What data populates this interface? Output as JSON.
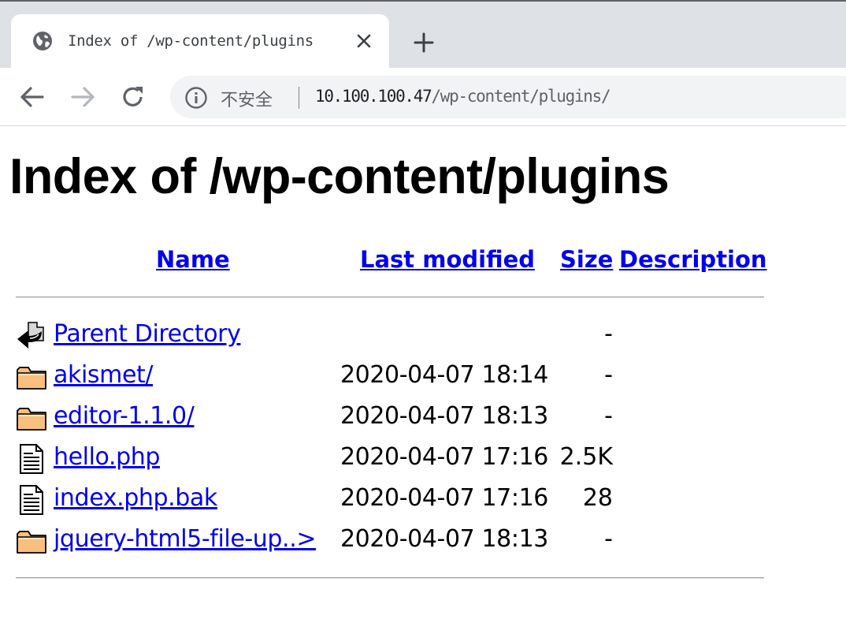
{
  "browser": {
    "tab_title": "Index of /wp-content/plugins",
    "security_label": "不安全",
    "url_host": "10.100.100.47",
    "url_path": "/wp-content/plugins/",
    "icons": {
      "tab": "globe-icon",
      "close": "close-icon",
      "new_tab": "plus-icon",
      "back": "back-arrow-icon",
      "forward": "forward-arrow-icon",
      "reload": "reload-icon",
      "security": "info-icon"
    }
  },
  "page": {
    "title": "Index of /wp-content/plugins",
    "columns": {
      "name": "Name",
      "last_modified": "Last modified",
      "size": "Size",
      "description": "Description"
    },
    "link_color": "#0000ee",
    "rows": [
      {
        "icon": "back-icon",
        "name": "Parent Directory",
        "modified": "",
        "size": "-",
        "description": ""
      },
      {
        "icon": "folder-icon",
        "name": "akismet/",
        "modified": "2020-04-07 18:14",
        "size": "-",
        "description": ""
      },
      {
        "icon": "folder-icon",
        "name": "editor-1.1.0/",
        "modified": "2020-04-07 18:13",
        "size": "-",
        "description": ""
      },
      {
        "icon": "file-icon",
        "name": "hello.php",
        "modified": "2020-04-07 17:16",
        "size": "2.5K",
        "description": ""
      },
      {
        "icon": "file-icon",
        "name": "index.php.bak",
        "modified": "2020-04-07 17:16",
        "size": "28",
        "description": ""
      },
      {
        "icon": "folder-icon",
        "name": "jquery-html5-file-up..>",
        "modified": "2020-04-07 18:13",
        "size": "-",
        "description": ""
      }
    ]
  }
}
